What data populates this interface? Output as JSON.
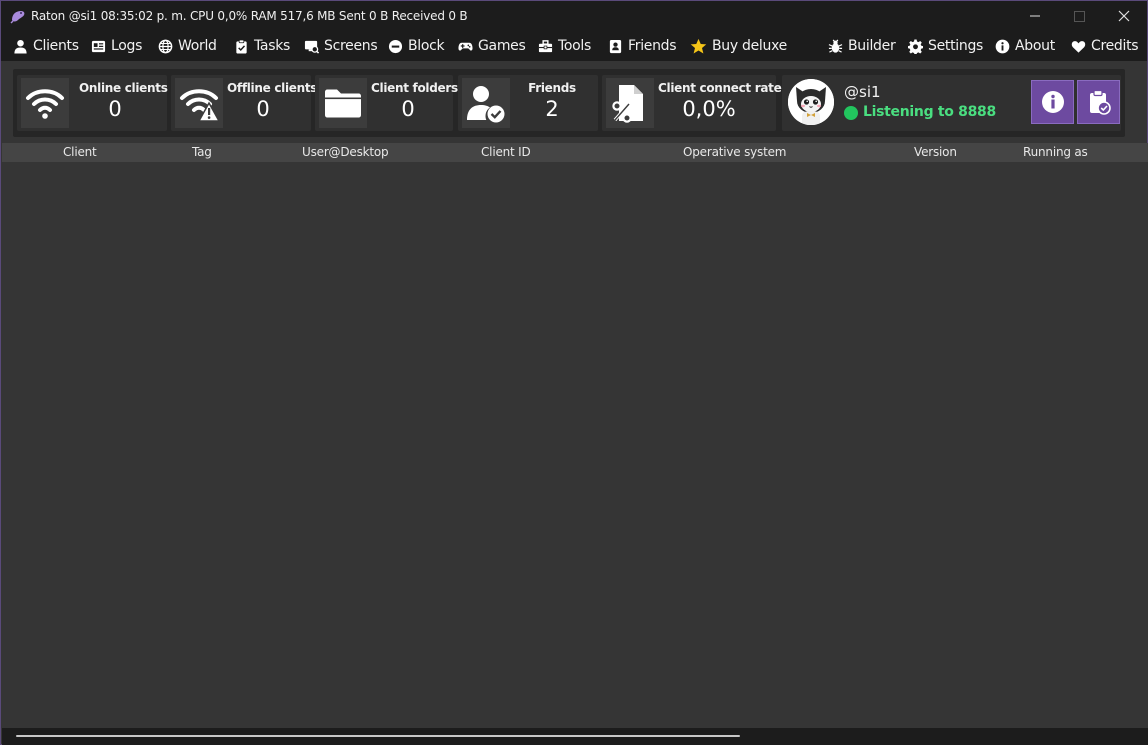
{
  "window": {
    "title": "Raton @si1 08:35:02 p. m. CPU 0,0% RAM 517,6 MB Sent 0 B Received 0 B",
    "controls": {
      "minimize": "—",
      "maximize": "☐",
      "close": "✕"
    }
  },
  "menu": {
    "clients": "Clients",
    "logs": "Logs",
    "world": "World",
    "tasks": "Tasks",
    "screens": "Screens",
    "block": "Block",
    "games": "Games",
    "tools": "Tools",
    "friends": "Friends",
    "buy_deluxe": "Buy deluxe",
    "builder": "Builder",
    "settings": "Settings",
    "about": "About",
    "credits": "Credits"
  },
  "stats": {
    "online_clients": {
      "label": "Online clients",
      "value": "0",
      "icon": "wifi-icon"
    },
    "offline_clients": {
      "label": "Offline clients",
      "value": "0",
      "icon": "wifi-warning-icon"
    },
    "client_folders": {
      "label": "Client folders",
      "value": "0",
      "icon": "folder-icon"
    },
    "friends": {
      "label": "Friends",
      "value": "2",
      "icon": "user-check-icon"
    },
    "connect_rate": {
      "label": "Client connect rate",
      "value": "0,0%",
      "icon": "percent-file-icon"
    }
  },
  "profile": {
    "username": "@si1",
    "status": "Listening to 8888",
    "status_color": "#22c55e"
  },
  "table": {
    "columns": [
      "Client",
      "Tag",
      "User@Desktop",
      "Client ID",
      "Operative system",
      "Version",
      "Running as"
    ],
    "rows": []
  },
  "colors": {
    "accent": "#6d4aa0",
    "titlebar": "#1c1c1c",
    "background": "#353535",
    "deluxe_star": "#f5c518"
  }
}
